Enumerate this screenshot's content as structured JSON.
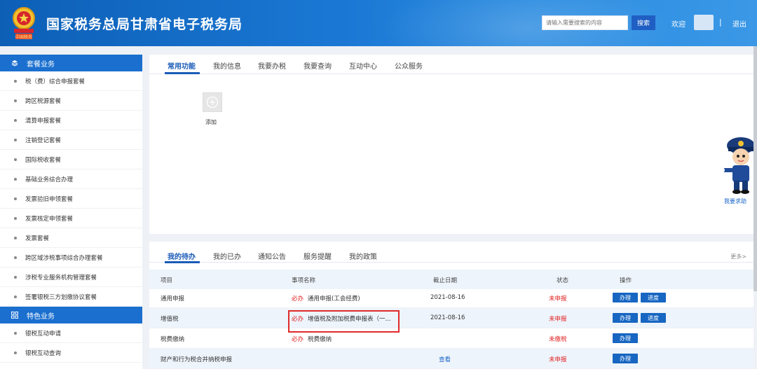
{
  "header": {
    "title": "国家税务总局甘肃省电子税务局",
    "emblem_text": "中国税务",
    "search_placeholder": "请输入需要搜索的内容",
    "search_button": "搜索",
    "welcome": "欢迎",
    "separator": "|",
    "logout": "退出"
  },
  "sidebar": {
    "category1": "套餐业务",
    "items1": [
      "税（费）综合申报套餐",
      "跨区税源套餐",
      "清算申报套餐",
      "注销登记套餐",
      "国际税收套餐",
      "基础业务综合办理",
      "发票验旧申领套餐",
      "发票核定申领套餐",
      "发票套餐",
      "跨区域涉税事项综合办理套餐",
      "涉税专业服务机构管理套餐",
      "签署银税三方划缴协议套餐"
    ],
    "category2": "特色业务",
    "items2": [
      "银税互动申请",
      "银税互动查询"
    ]
  },
  "top_panel": {
    "tabs": [
      "常用功能",
      "我的信息",
      "我要办税",
      "我要查询",
      "互动中心",
      "公众服务"
    ],
    "add_label": "添加"
  },
  "mascot_label": "我要求助",
  "bottom_panel": {
    "tabs": [
      "我的待办",
      "我的已办",
      "通知公告",
      "服务提醒",
      "我的政策"
    ],
    "more": "更多>",
    "columns": [
      "项目",
      "事项名称",
      "截止日期",
      "状态",
      "操作"
    ],
    "rows": [
      {
        "project": "通用申报",
        "must": "必办",
        "name": "通用申报(工会经费)",
        "date": "2021-08-16",
        "status": "未申报",
        "actions": [
          "办理",
          "进度"
        ]
      },
      {
        "project": "增值税",
        "must": "必办",
        "name": "增值税及附加税费申报表（一...",
        "date": "2021-08-16",
        "status": "未申报",
        "actions": [
          "办理",
          "进度"
        ]
      },
      {
        "project": "税费缴纳",
        "must": "必办",
        "name": "税费缴纳",
        "date": "",
        "status": "未缴税",
        "actions": [
          "办理"
        ]
      },
      {
        "project": "财产和行为税合并纳税申报",
        "must": "",
        "name": "",
        "date": "查看",
        "status": "未申报",
        "actions": [
          "办理"
        ]
      }
    ]
  },
  "colors": {
    "header_blue": "#1a78d4",
    "accent": "#1a5bb8",
    "alert_red": "#e02020"
  }
}
